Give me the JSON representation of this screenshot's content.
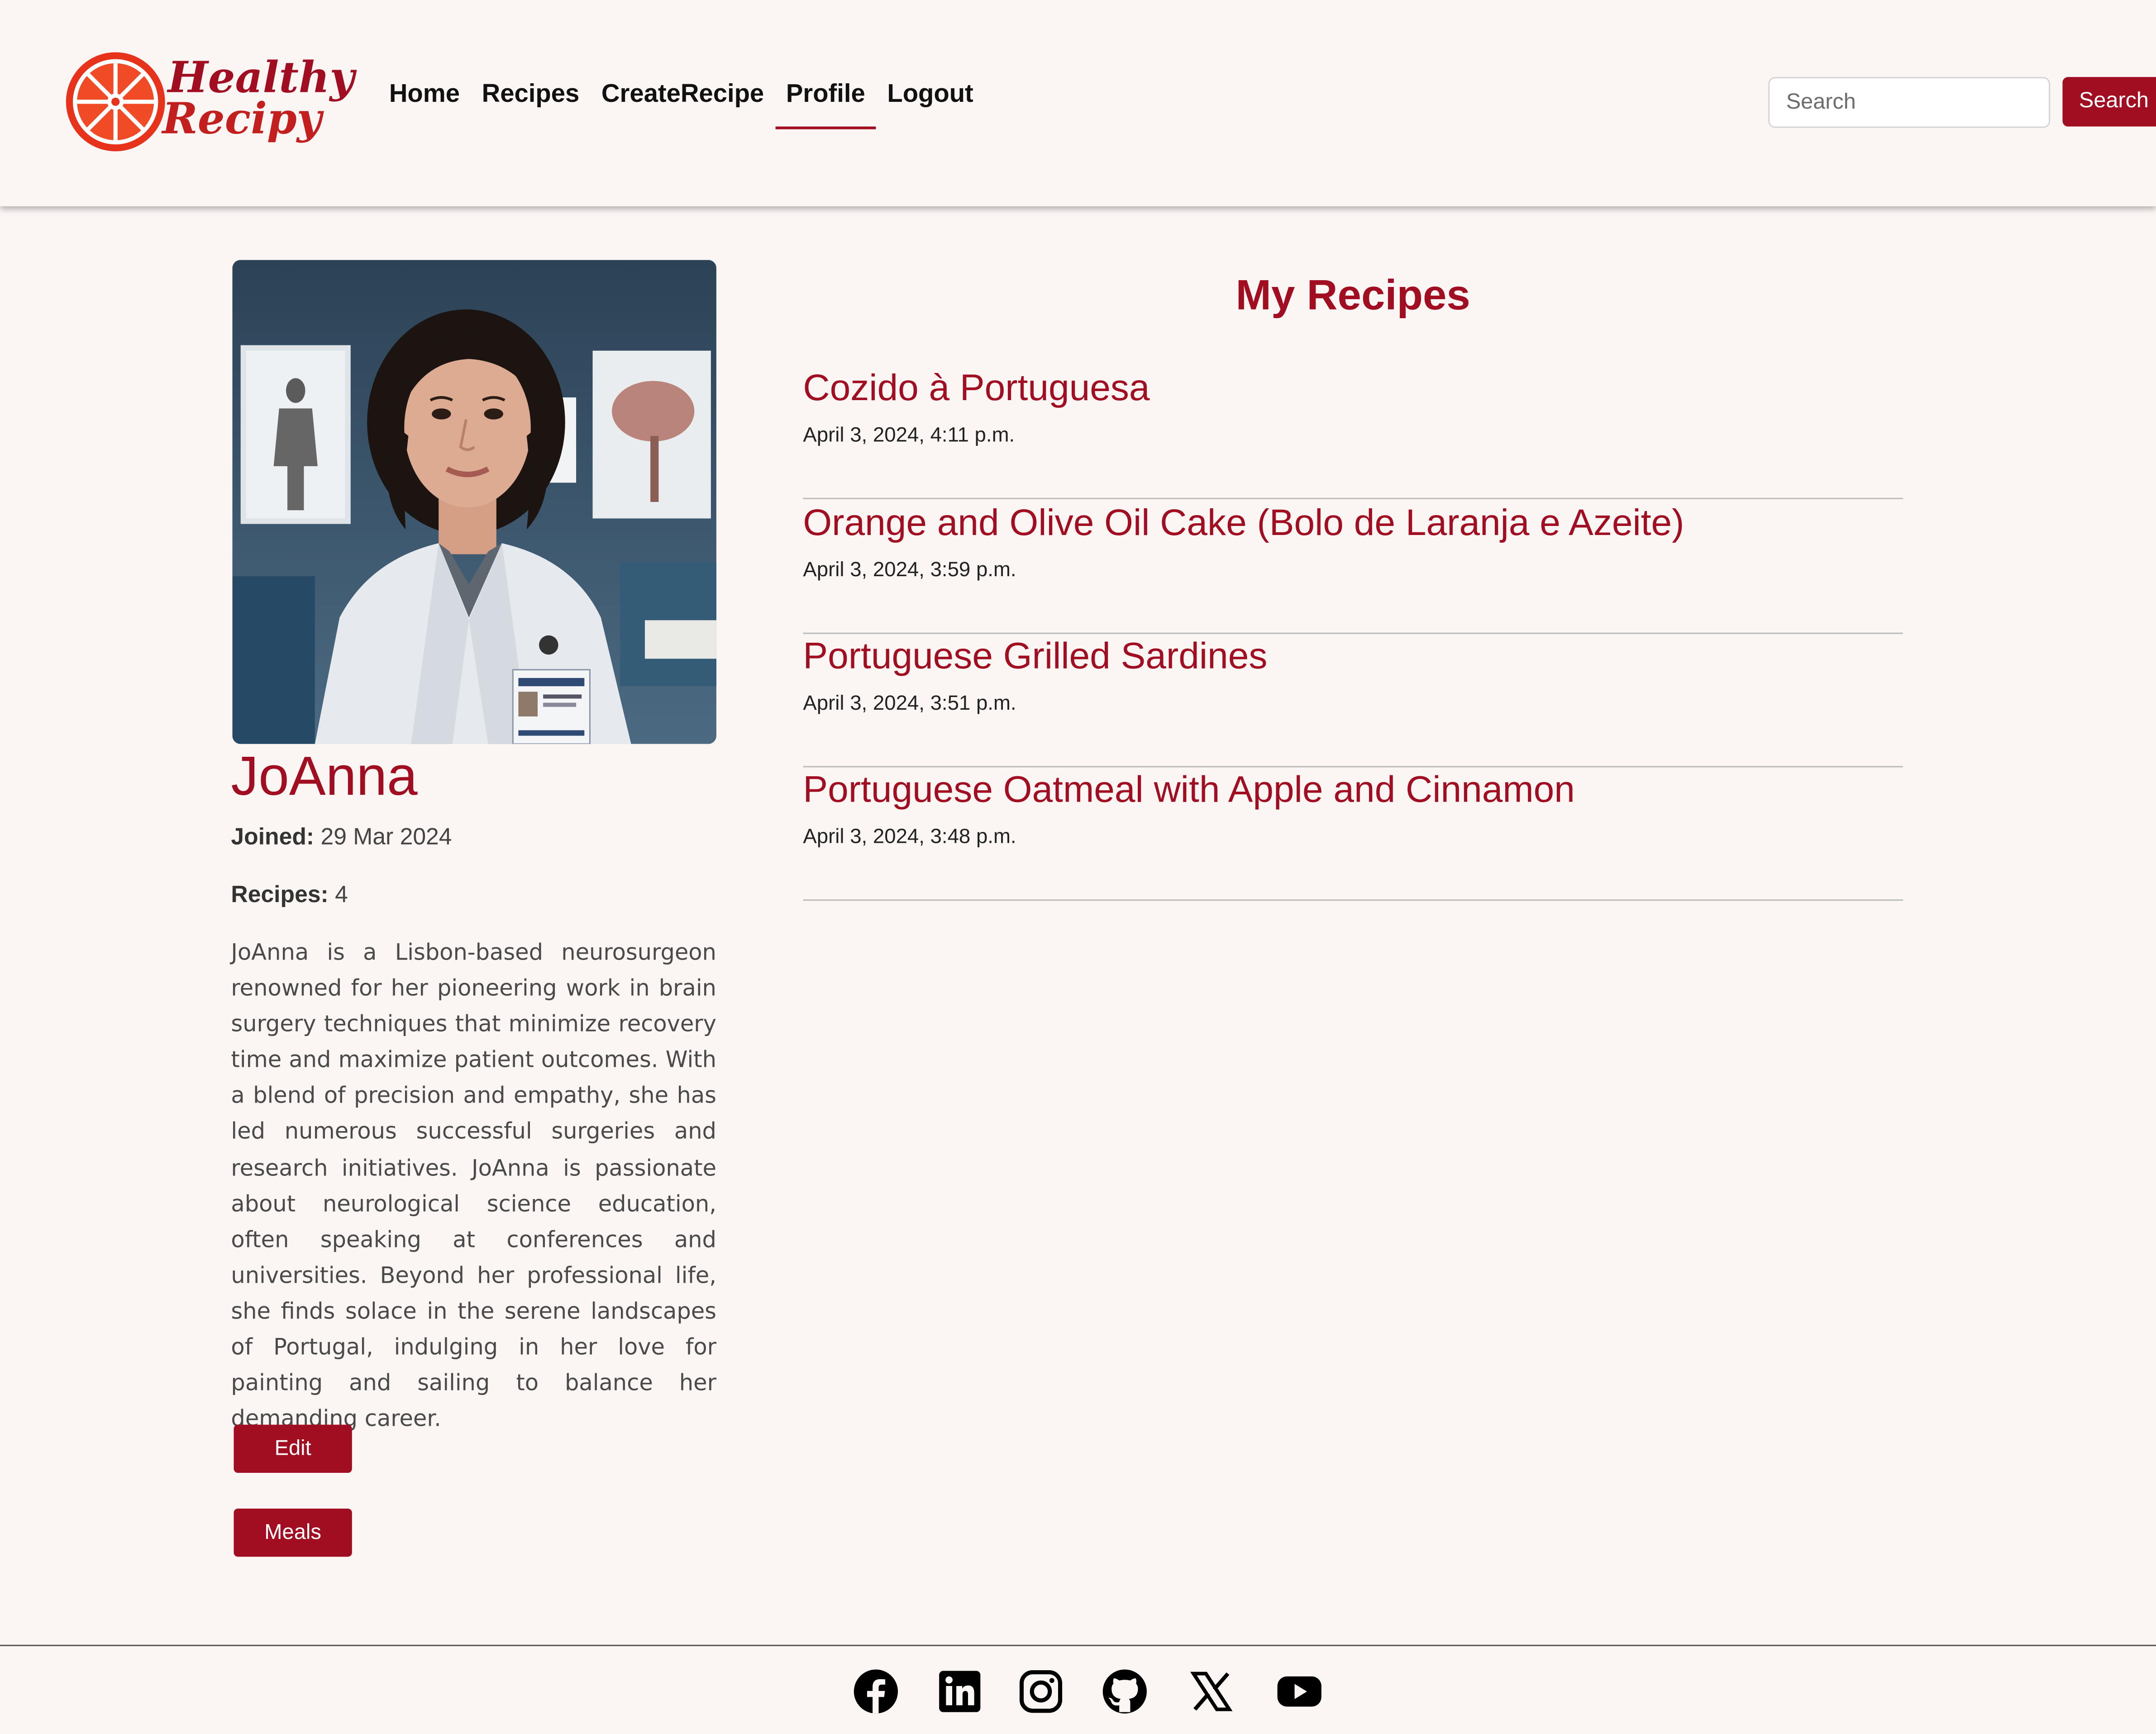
{
  "brand": {
    "line1": "Healthy",
    "line2": "Recipy",
    "accent_color": "#a20e21",
    "logo_icon": "citrus-slice-icon"
  },
  "nav": {
    "items": [
      {
        "label": "Home"
      },
      {
        "label": "Recipes"
      },
      {
        "label": "CreateRecipe"
      },
      {
        "label": "Profile",
        "active": true
      },
      {
        "label": "Logout"
      }
    ]
  },
  "search": {
    "placeholder": "Search",
    "value": "",
    "button_label": "Search"
  },
  "profile": {
    "name": "JoAnna",
    "joined_label": "Joined:",
    "joined_value": "29 Mar 2024",
    "recipes_label": "Recipes:",
    "recipes_count": "4",
    "bio": "JoAnna is a Lisbon-based neurosurgeon renowned for her pioneering work in brain surgery techniques that minimize recovery time and maximize patient outcomes. With a blend of precision and empathy, she has led numerous successful surgeries and research initiatives. JoAnna is passionate about neurological science education, often speaking at conferences and universities. Beyond her professional life, she finds solace in the serene landscapes of Portugal, indulging in her love for painting and sailing to balance her demanding career.",
    "edit_label": "Edit",
    "meals_label": "Meals",
    "avatar_icon": "profile-photo"
  },
  "my_recipes": {
    "title": "My Recipes",
    "items": [
      {
        "title": "Cozido à Portuguesa",
        "date": "April 3, 2024, 4:11 p.m."
      },
      {
        "title": "Orange and Olive Oil Cake (Bolo de Laranja e Azeite)",
        "date": "April 3, 2024, 3:59 p.m."
      },
      {
        "title": "Portuguese Grilled Sardines",
        "date": "April 3, 2024, 3:51 p.m."
      },
      {
        "title": "Portuguese Oatmeal with Apple and Cinnamon",
        "date": "April 3, 2024, 3:48 p.m."
      }
    ]
  },
  "footer": {
    "social_icons": [
      "facebook-icon",
      "linkedin-icon",
      "instagram-icon",
      "github-icon",
      "x-icon",
      "youtube-icon"
    ]
  }
}
